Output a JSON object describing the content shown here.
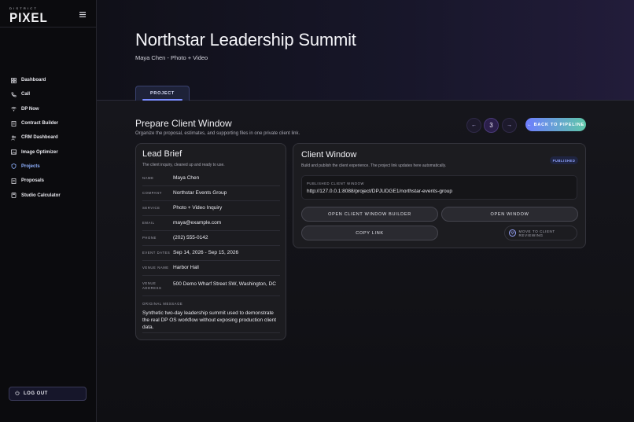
{
  "brand": {
    "small": "DISTRICT",
    "big": "PIXEL"
  },
  "sidebar": {
    "items": [
      {
        "label": "Dashboard",
        "icon": "dashboard-icon"
      },
      {
        "label": "Call",
        "icon": "phone-icon"
      },
      {
        "label": "DP Now",
        "icon": "wifi-icon"
      },
      {
        "label": "Contract Builder",
        "icon": "document-icon"
      },
      {
        "label": "CRM Dashboard",
        "icon": "users-icon"
      },
      {
        "label": "Image Optimizer",
        "icon": "image-icon"
      },
      {
        "label": "Projects",
        "icon": "shield-icon",
        "active": true
      },
      {
        "label": "Proposals",
        "icon": "document-icon"
      },
      {
        "label": "Studio Calculator",
        "icon": "calculator-icon"
      }
    ],
    "logout_label": "LOG OUT"
  },
  "header": {
    "title": "Northstar Leadership Summit",
    "subtitle": "Maya Chen - Photo + Video",
    "tab_label": "PROJECT"
  },
  "section": {
    "title": "Prepare Client Window",
    "subtitle": "Organize the proposal, estimates, and supporting files in one private client link.",
    "prev_glyph": "←",
    "page_number": "3",
    "next_glyph": "→",
    "back_label": "← BACK TO PIPELINE"
  },
  "lead": {
    "title": "Lead Brief",
    "subtitle": "The client inquiry, cleaned up and ready to use.",
    "rows": [
      {
        "key": "NAME",
        "value": "Maya Chen"
      },
      {
        "key": "COMPANY",
        "value": "Northstar Events Group"
      },
      {
        "key": "SERVICE",
        "value": "Photo + Video Inquiry"
      },
      {
        "key": "EMAIL",
        "value": "maya@example.com"
      },
      {
        "key": "PHONE",
        "value": "(202) 555-0142"
      },
      {
        "key": "EVENT DATES",
        "value": "Sep 14, 2026 - Sep 15, 2026"
      },
      {
        "key": "VENUE NAME",
        "value": "Harbor Hall"
      },
      {
        "key": "VENUE ADDRESS",
        "value": "500 Demo Wharf Street SW, Washington, DC"
      }
    ],
    "message_key": "ORIGINAL MESSAGE",
    "message_value": "Synthetic two-day leadership summit used to demonstrate the real DP OS workflow without exposing production client data."
  },
  "client_window": {
    "title": "Client Window",
    "subtitle": "Build and publish the client experience. The project link updates here automatically.",
    "badge": "PUBLISHED",
    "url_label": "PUBLISHED CLIENT WINDOW",
    "url": "http://127.0.0.1:8088/project/DPJUDGE1/northstar-events-group",
    "btn_builder": "OPEN CLIENT WINDOW BUILDER",
    "btn_open": "OPEN WINDOW",
    "btn_copy": "COPY LINK",
    "btn_move": "MOVE TO CLIENT REVIEWING"
  },
  "colors": {
    "accent": "#7a8cff",
    "gradient_start": "#6e7dff",
    "gradient_end": "#5ec7a8",
    "active_nav": "#8fb1ff"
  }
}
